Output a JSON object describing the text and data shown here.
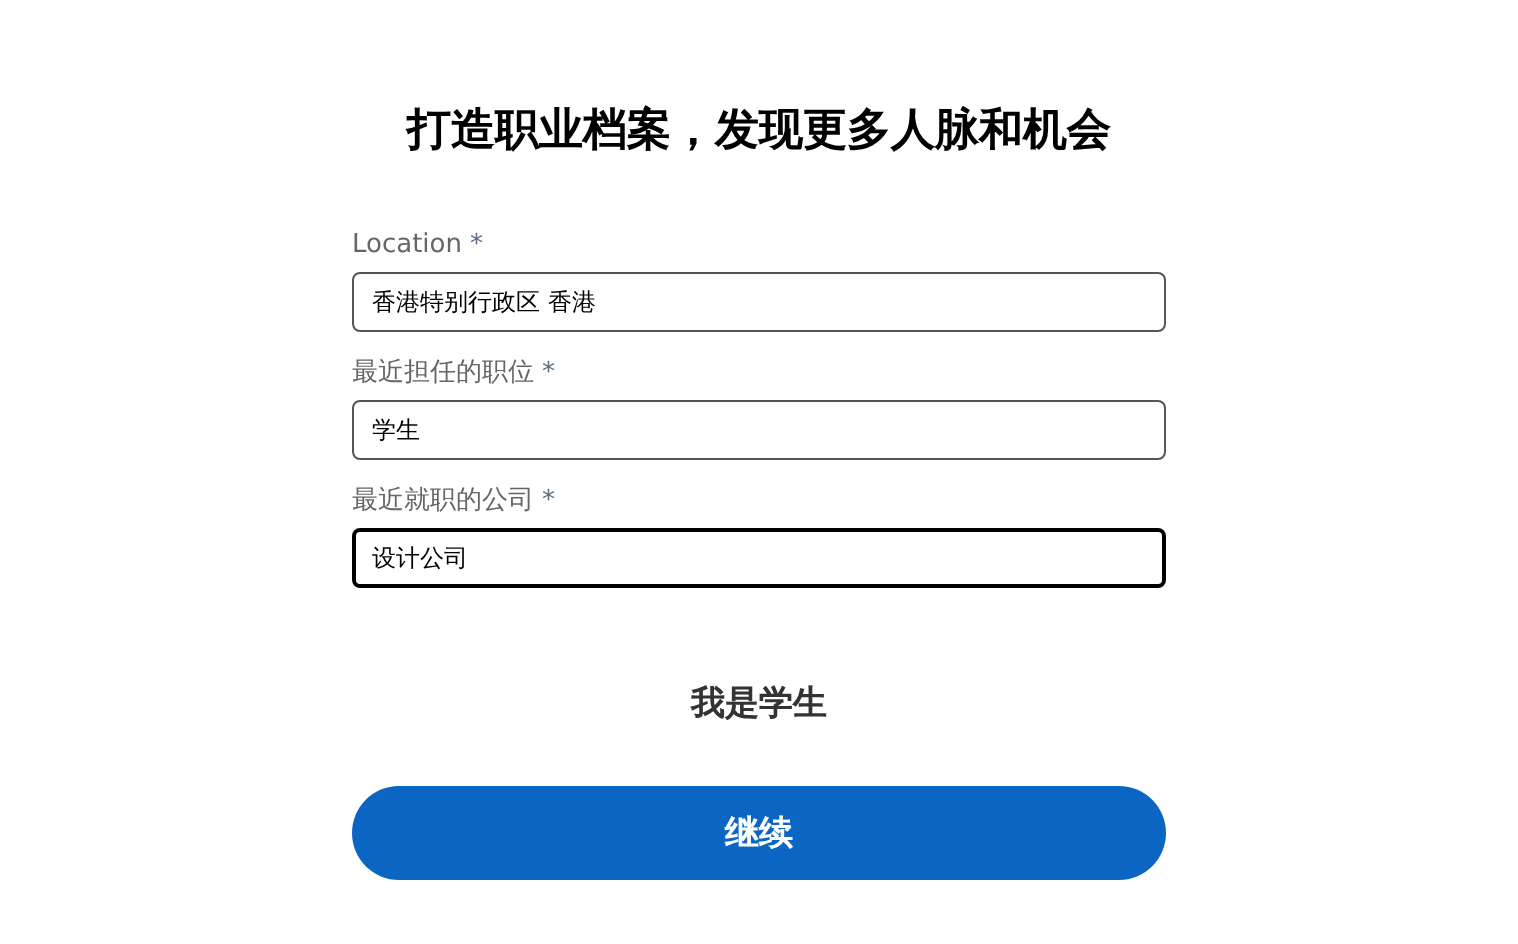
{
  "heading": "打造职业档案，发现更多人脉和机会",
  "fields": [
    {
      "label": "Location",
      "required_mark": "*",
      "value": "香港特别行政区 香港",
      "focused": false
    },
    {
      "label": "最近担任的职位",
      "required_mark": "*",
      "value": "学生",
      "focused": false
    },
    {
      "label": "最近就职的公司",
      "required_mark": "*",
      "value": "设计公司",
      "focused": true
    }
  ],
  "student_link": "我是学生",
  "continue_button": "继续"
}
